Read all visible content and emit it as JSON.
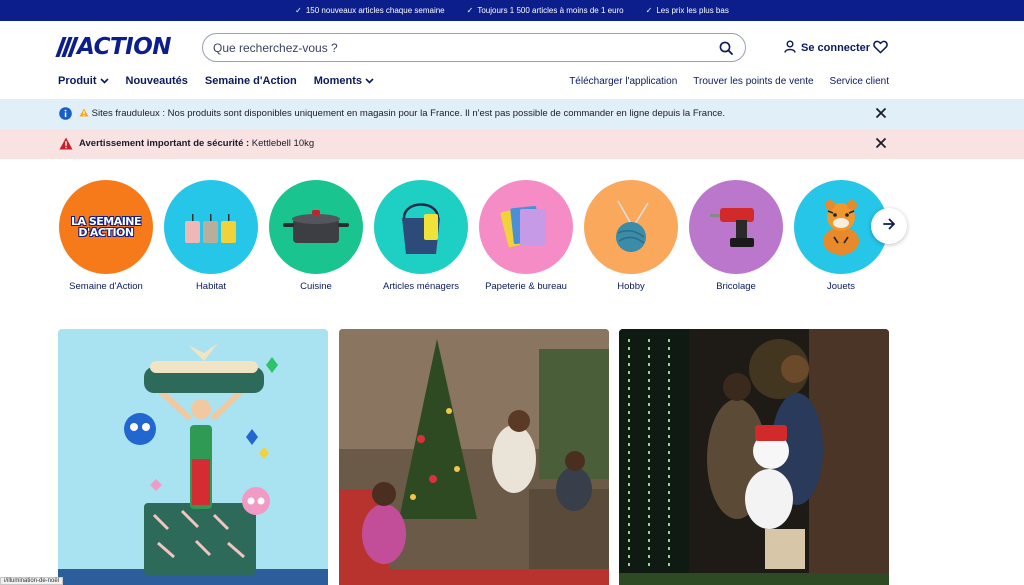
{
  "topbar": {
    "promos": [
      "150 nouveaux articles chaque semaine",
      "Toujours 1 500 articles à moins de 1 euro",
      "Les prix les plus bas"
    ]
  },
  "header": {
    "logo_text": "ACTION",
    "search": {
      "placeholder": "Que recherchez-vous ?",
      "value": ""
    },
    "login_label": "Se connecter"
  },
  "nav": {
    "left": [
      "Produit",
      "Nouveautés",
      "Semaine d'Action",
      "Moments"
    ],
    "right": [
      "Télécharger l'application",
      "Trouver les points de vente",
      "Service client"
    ]
  },
  "alerts": {
    "info": {
      "text": "Sites frauduleux : Nos produits sont disponibles uniquement en magasin pour la France. Il n'est pas possible de commander en ligne depuis la France."
    },
    "warning": {
      "title": "Avertissement important de sécurité :",
      "text": " Kettlebell 10kg"
    }
  },
  "categories": [
    {
      "label": "Semaine d'Action",
      "color": "#f77a1a",
      "badge_line1": "LA SEMAINE",
      "badge_line2": "D'ACTION"
    },
    {
      "label": "Habitat",
      "color": "#26c6e8"
    },
    {
      "label": "Cuisine",
      "color": "#19c48e"
    },
    {
      "label": "Articles ménagers",
      "color": "#1ecfc4"
    },
    {
      "label": "Papeterie & bureau",
      "color": "#f58cc6"
    },
    {
      "label": "Hobby",
      "color": "#f9a85c"
    },
    {
      "label": "Bricolage",
      "color": "#bb77cc"
    },
    {
      "label": "Jouets",
      "color": "#26c6e8"
    }
  ],
  "status_bar": {
    "url": "i/illumination-de-noël"
  },
  "colors": {
    "brand": "#0b1e8c",
    "info_bg": "#e1eff8",
    "warn_bg": "#f9e2e2"
  }
}
